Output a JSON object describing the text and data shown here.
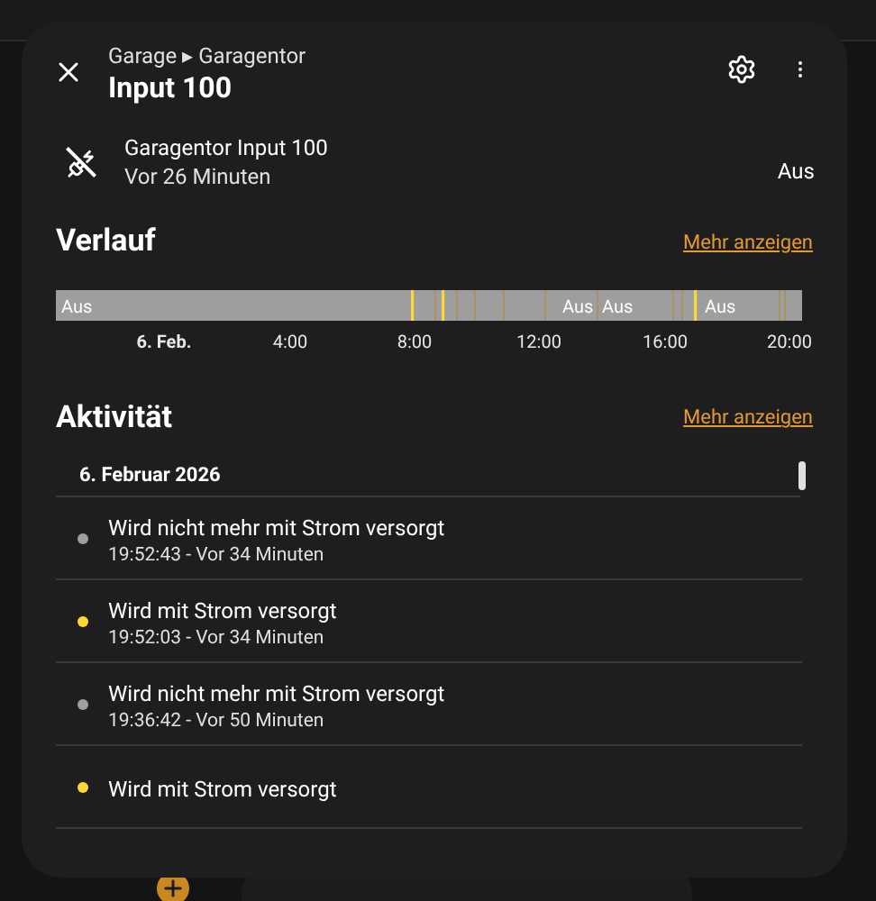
{
  "dialog": {
    "breadcrumb": "Garage ▸ Garagentor",
    "title": "Input 100"
  },
  "entity": {
    "name": "Garagentor Input 100",
    "last_changed": "Vor 26 Minuten",
    "state": "Aus",
    "powered": false
  },
  "history": {
    "title": "Verlauf",
    "more_link": "Mehr anzeigen",
    "segment_labels": [
      "Aus",
      "Aus",
      "Aus",
      "Aus"
    ],
    "axis_labels": [
      "6. Feb.",
      "4:00",
      "8:00",
      "12:00",
      "16:00",
      "20:00"
    ]
  },
  "activity": {
    "title": "Aktivität",
    "more_link": "Mehr anzeigen",
    "date": "6. Februar 2026",
    "entries": [
      {
        "message": "Wird nicht mehr mit Strom versorgt",
        "time": "19:52:43 - Vor 34 Minuten",
        "color": "#9e9e9e"
      },
      {
        "message": "Wird mit Strom versorgt",
        "time": "19:52:03 - Vor 34 Minuten",
        "color": "#fdd835"
      },
      {
        "message": "Wird nicht mehr mit Strom versorgt",
        "time": "19:36:42 - Vor 50 Minuten",
        "color": "#9e9e9e"
      },
      {
        "message": "Wird mit Strom versorgt",
        "color": "#fdd835"
      }
    ]
  }
}
